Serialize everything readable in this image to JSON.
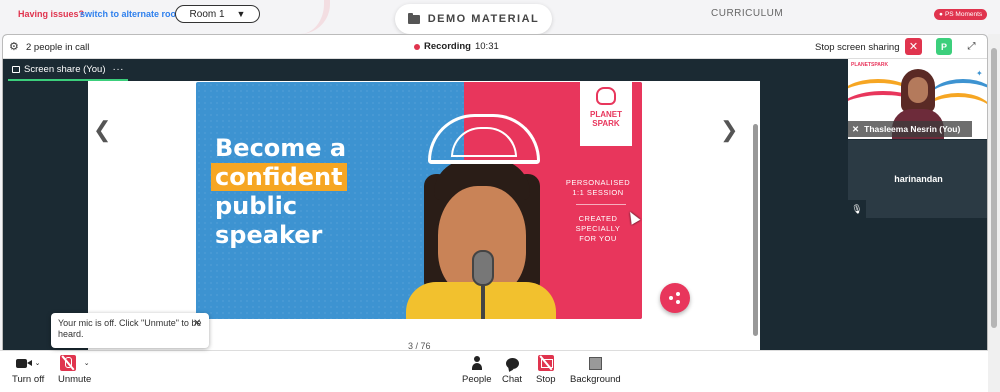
{
  "topbar": {
    "issues_label": "Having issues?",
    "alt_room_link": "switch to alternate room",
    "room_select_value": "Room 1",
    "demo_button": "DEMO MATERIAL",
    "curriculum_tab": "CURRICULUM",
    "ps_moments_badge": "PS Moments"
  },
  "call_header": {
    "participants": "2 people in call",
    "recording_label": "Recording",
    "recording_time": "10:31",
    "stop_sharing": "Stop screen sharing",
    "avatar_initial": "P"
  },
  "share_tab": {
    "label": "Screen share (You)",
    "menu": "···"
  },
  "slide": {
    "headline_line1": "Become a",
    "headline_line2": "confident",
    "headline_line3": "public",
    "headline_line4": "speaker",
    "logo_line1": "PLANET",
    "logo_line2": "SPARK",
    "info1_line1": "PERSONALISED",
    "info1_line2": "1:1 SESSION",
    "info2_line1": "CREATED SPECIALLY",
    "info2_line2": "FOR YOU",
    "page_indicator": "3 / 76"
  },
  "participants": [
    {
      "name": "Thasleema Nesrin (You)"
    },
    {
      "name": "harinandan"
    }
  ],
  "tile_logo": "PLANETSPARK",
  "toolbar": {
    "camera": "Turn off",
    "mic": "Unmute",
    "people": "People",
    "chat": "Chat",
    "stop": "Stop",
    "background": "Background"
  },
  "tooltip": {
    "text": "Your mic is off. Click \"Unmute\" to be heard.",
    "close": "✕"
  },
  "colors": {
    "accent_red": "#e0344e",
    "brand_pink": "#e8365c",
    "slide_blue": "#3d93d1",
    "highlight_orange": "#f6a623",
    "avatar_green": "#3ccf7c",
    "dark_panel": "#1b2a33"
  }
}
